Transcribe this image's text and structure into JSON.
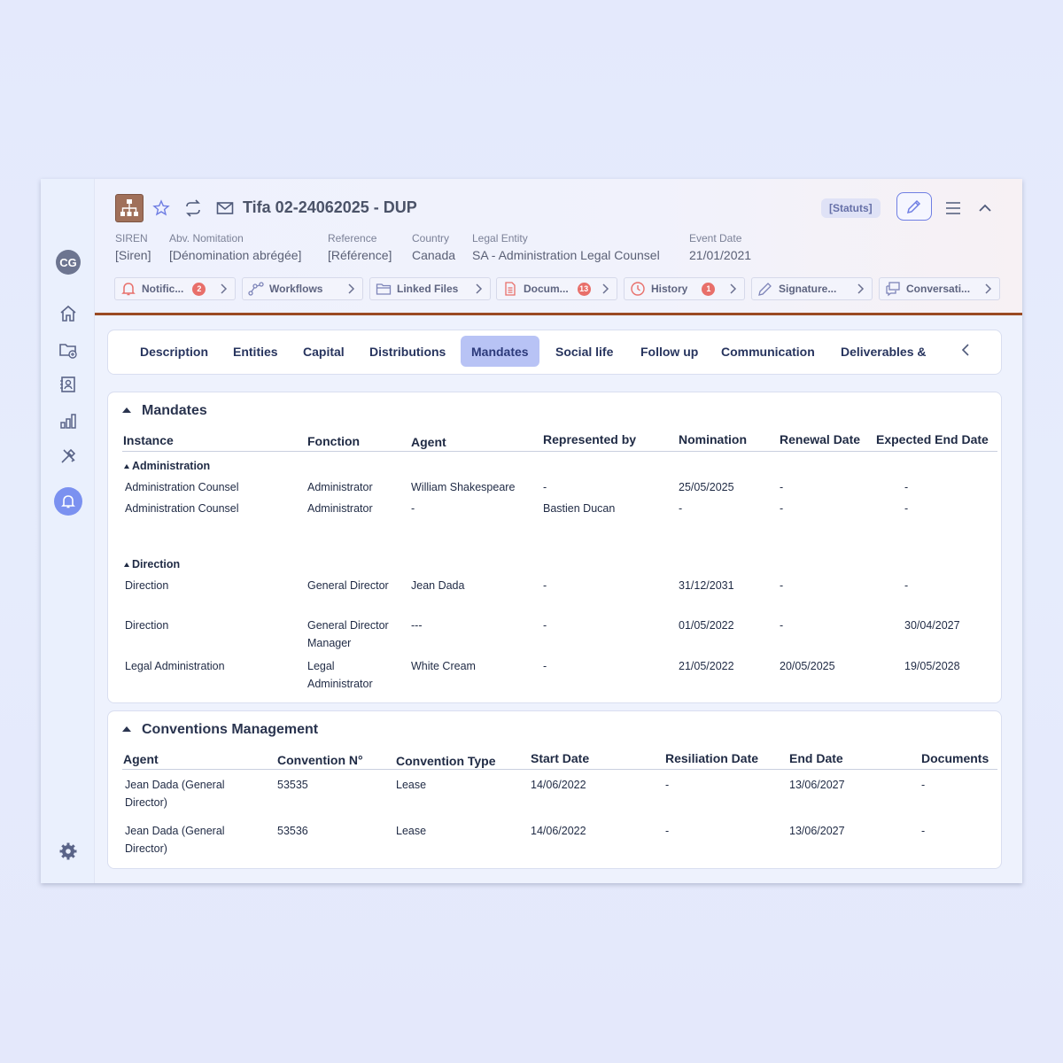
{
  "rail": {
    "avatar": "CG"
  },
  "header": {
    "title": "Tifa 02-24062025 - DUP",
    "status_badge": "[Statuts]",
    "meta": [
      {
        "label": "SIREN",
        "value": "[Siren]"
      },
      {
        "label": "Abv. Nomitation",
        "value": "[Dénomination abrégée]"
      },
      {
        "label": "Reference",
        "value": "[Référence]"
      },
      {
        "label": "Country",
        "value": "Canada"
      },
      {
        "label": "Legal Entity",
        "value": "SA - Administration Legal Counsel"
      },
      {
        "label": "Event Date",
        "value": "21/01/2021"
      }
    ],
    "chips": [
      {
        "label": "Notific...",
        "badge": "2",
        "icon": "bell-icon"
      },
      {
        "label": "Workflows",
        "badge": "",
        "icon": "workflow-icon"
      },
      {
        "label": "Linked Files",
        "badge": "",
        "icon": "folder-icon"
      },
      {
        "label": "Docum...",
        "badge": "13",
        "icon": "document-icon"
      },
      {
        "label": "History",
        "badge": "1",
        "icon": "clock-icon"
      },
      {
        "label": "Signature...",
        "badge": "",
        "icon": "pen-icon"
      },
      {
        "label": "Conversati...",
        "badge": "",
        "icon": "chat-icon"
      }
    ]
  },
  "tabs": [
    {
      "label": "Description"
    },
    {
      "label": "Entities"
    },
    {
      "label": "Capital"
    },
    {
      "label": "Distributions"
    },
    {
      "label": "Mandates",
      "active": true
    },
    {
      "label": "Social  life"
    },
    {
      "label": "Follow up"
    },
    {
      "label": "Communication"
    },
    {
      "label": "Deliverables &"
    }
  ],
  "mandates": {
    "title": "Mandates",
    "columns": [
      "Instance",
      "Fonction",
      "Agent",
      "Represented by",
      "Nomination",
      "Renewal Date",
      "Expected End Date"
    ],
    "groups": [
      {
        "name": "Administration",
        "rows": [
          [
            "Administration Counsel",
            "Administrator",
            "William Shakespeare",
            "-",
            "25/05/2025",
            "-",
            "-"
          ],
          [
            "Administration Counsel",
            "Administrator",
            "-",
            "Bastien Ducan",
            "-",
            "-",
            "-"
          ]
        ]
      },
      {
        "name": "Direction",
        "rows": [
          [
            "Direction",
            "General Director",
            "Jean Dada",
            "-",
            "31/12/2031",
            "-",
            "-"
          ],
          [
            "Direction",
            "General Director Manager",
            "---",
            "-",
            "01/05/2022",
            "-",
            "30/04/2027"
          ],
          [
            "Legal Administration",
            "Legal Administrator",
            "White Cream",
            "-",
            "21/05/2022",
            "20/05/2025",
            "19/05/2028"
          ]
        ]
      }
    ]
  },
  "conventions": {
    "title": "Conventions Management",
    "columns": [
      "Agent",
      "Convention N°",
      "Convention Type",
      "Start Date",
      "Resiliation Date",
      "End Date",
      "Documents"
    ],
    "rows": [
      [
        "Jean Dada (General Director)",
        "53535",
        "Lease",
        "14/06/2022",
        "-",
        "13/06/2027",
        "-"
      ],
      [
        "Jean Dada (General Director)",
        "53536",
        "Lease",
        "14/06/2022",
        "-",
        "13/06/2027",
        "-"
      ]
    ]
  }
}
